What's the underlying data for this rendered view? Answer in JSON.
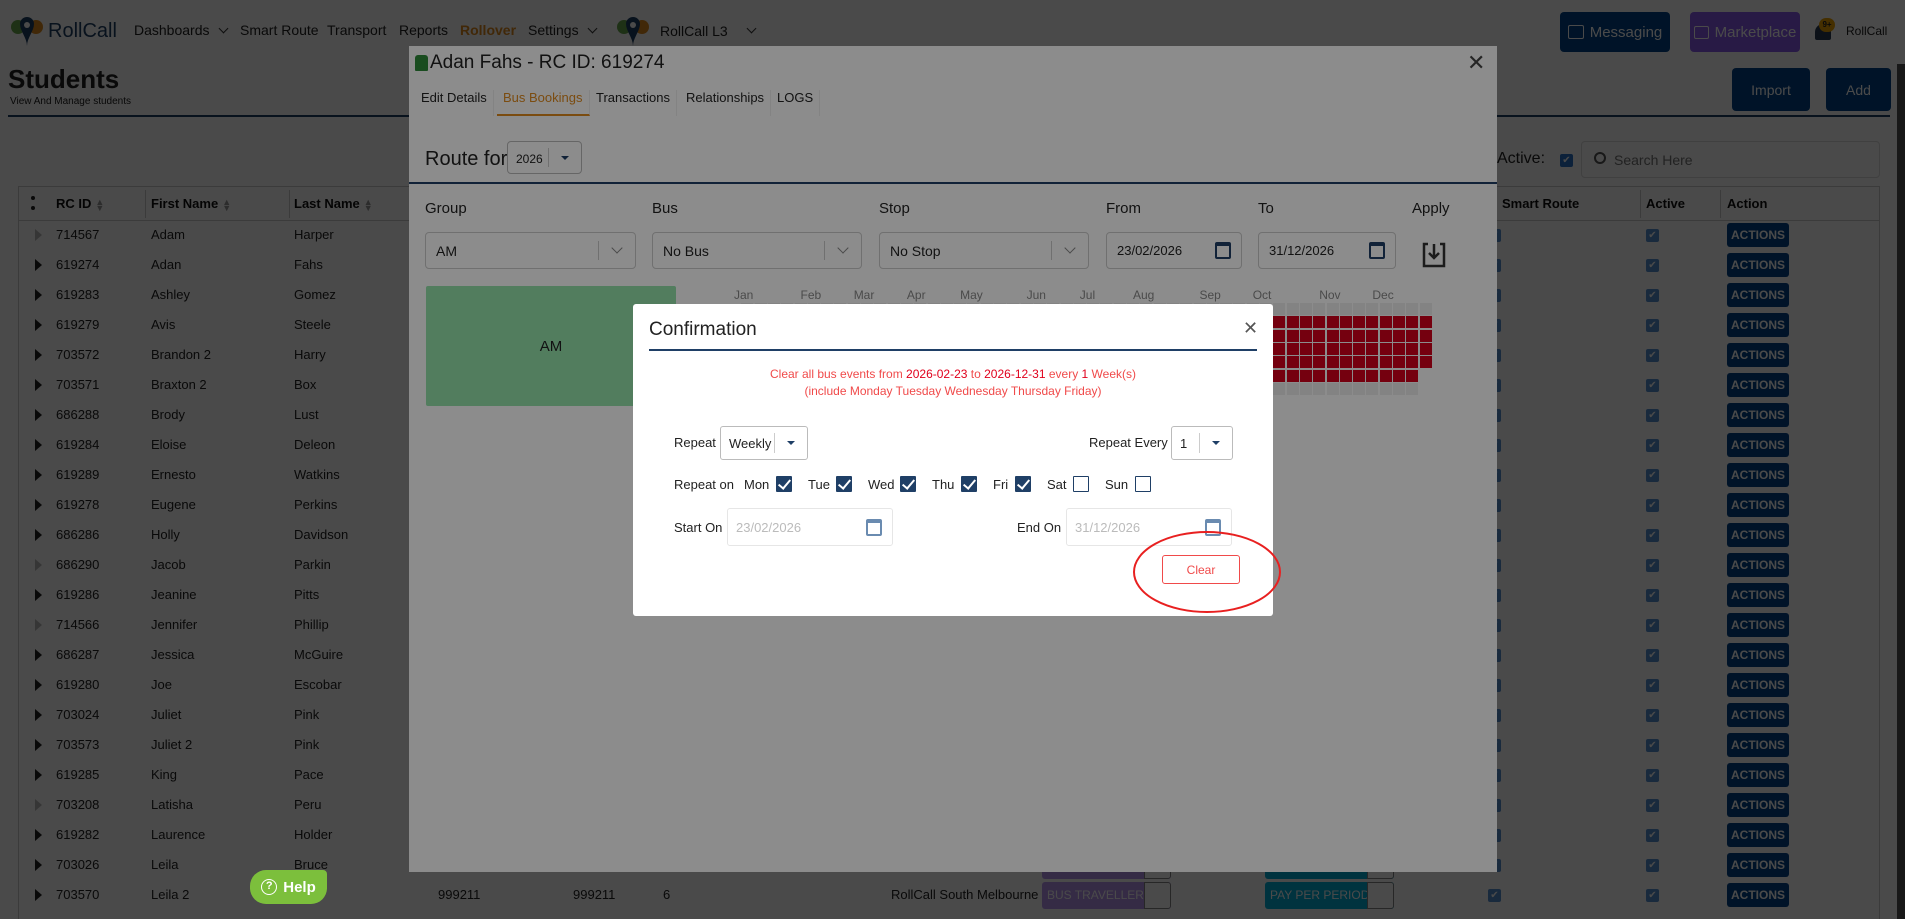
{
  "nav": {
    "brand": "RollCall",
    "items": [
      "Dashboards",
      "Smart Route",
      "Transport",
      "Reports",
      "Rollover",
      "Settings"
    ],
    "school": "RollCall L3",
    "messaging": "Messaging",
    "marketplace": "Marketplace",
    "notification_count": "9+",
    "user": "RollCall"
  },
  "page": {
    "title": "Students",
    "subtitle": "View And Manage students",
    "import": "Import",
    "add": "Add",
    "active_label": "Active:",
    "search_placeholder": "Search Here",
    "help": "Help"
  },
  "table": {
    "headers": {
      "rc_id": "RC ID",
      "first_name": "First Name",
      "last_name": "Last Name",
      "smart_route": "Smart Route",
      "active": "Active",
      "action": "Action"
    },
    "action_label": "ACTIONS",
    "rows": [
      {
        "id": "714567",
        "first": "Adam",
        "last": "Harper",
        "expandable": false
      },
      {
        "id": "619274",
        "first": "Adan",
        "last": "Fahs",
        "expandable": true
      },
      {
        "id": "619283",
        "first": "Ashley",
        "last": "Gomez",
        "expandable": true
      },
      {
        "id": "619279",
        "first": "Avis",
        "last": "Steele",
        "expandable": true
      },
      {
        "id": "703572",
        "first": "Brandon 2",
        "last": "Harry",
        "expandable": true
      },
      {
        "id": "703571",
        "first": "Braxton 2",
        "last": "Box",
        "expandable": true
      },
      {
        "id": "686288",
        "first": "Brody",
        "last": "Lust",
        "expandable": true
      },
      {
        "id": "619284",
        "first": "Eloise",
        "last": "Deleon",
        "expandable": true
      },
      {
        "id": "619289",
        "first": "Ernesto",
        "last": "Watkins",
        "expandable": true
      },
      {
        "id": "619278",
        "first": "Eugene",
        "last": "Perkins",
        "expandable": true
      },
      {
        "id": "686286",
        "first": "Holly",
        "last": "Davidson",
        "expandable": true
      },
      {
        "id": "686290",
        "first": "Jacob",
        "last": "Parkin",
        "expandable": false
      },
      {
        "id": "619286",
        "first": "Jeanine",
        "last": "Pitts",
        "expandable": true
      },
      {
        "id": "714566",
        "first": "Jennifer",
        "last": "Phillip",
        "expandable": false
      },
      {
        "id": "686287",
        "first": "Jessica",
        "last": "McGuire",
        "expandable": true
      },
      {
        "id": "619280",
        "first": "Joe",
        "last": "Escobar",
        "expandable": true
      },
      {
        "id": "703024",
        "first": "Juliet",
        "last": "Pink",
        "expandable": true
      },
      {
        "id": "703573",
        "first": "Juliet 2",
        "last": "Pink",
        "expandable": true
      },
      {
        "id": "619285",
        "first": "King",
        "last": "Pace",
        "expandable": true
      },
      {
        "id": "703208",
        "first": "Latisha",
        "last": "Peru",
        "expandable": false
      },
      {
        "id": "619282",
        "first": "Laurence",
        "last": "Holder",
        "expandable": true
      },
      {
        "id": "703026",
        "first": "Leila",
        "last": "Bruce",
        "expandable": true
      },
      {
        "id": "703570",
        "first": "Leila 2",
        "last": "",
        "expandable": true,
        "col4": "999211",
        "col5": "999211",
        "col6": "6",
        "campus": "RollCall South Melbourne",
        "type": "BUS TRAVELLER",
        "billing": "PAY PER PERIOD"
      }
    ]
  },
  "student_modal": {
    "title": "Adan Fahs - RC ID: 619274",
    "tabs": [
      "Edit Details",
      "Bus Bookings",
      "Transactions",
      "Relationships",
      "LOGS"
    ],
    "active_tab": "Bus Bookings",
    "route_for_label": "Route for",
    "year": "2026",
    "fields": {
      "group": "Group",
      "bus": "Bus",
      "stop": "Stop",
      "from": "From",
      "to": "To",
      "apply": "Apply"
    },
    "values": {
      "group": "AM",
      "bus": "No Bus",
      "stop": "No Stop",
      "from": "23/02/2026",
      "to": "31/12/2026"
    },
    "group_tile": "AM",
    "calendar": {
      "year": 2026,
      "months": [
        "Jan",
        "Feb",
        "Mar",
        "Apr",
        "May",
        "Jun",
        "Jul",
        "Aug",
        "Sep",
        "Oct",
        "Nov",
        "Dec"
      ],
      "booked_from": "2026-02-23",
      "booked_to": "2026-12-31",
      "booked_weekdays": [
        1,
        2,
        3,
        4,
        5
      ],
      "booked_color": "#d6001c",
      "empty_color": "#efefef"
    }
  },
  "confirm": {
    "title": "Confirmation",
    "msg_prefix": "Clear all bus events from ",
    "msg_from": "2026-02-23",
    "msg_to_word": " to ",
    "msg_to": "2026-12-31",
    "msg_every": " every ",
    "msg_n": "1",
    "msg_unit": " Week(s)",
    "msg_line2": "(include Monday Tuesday Wednesday Thursday Friday)",
    "repeat_label": "Repeat",
    "repeat_value": "Weekly",
    "repeat_every_label": "Repeat Every",
    "repeat_every_value": "1",
    "repeat_on_label": "Repeat on",
    "days": [
      {
        "label": "Mon",
        "checked": true
      },
      {
        "label": "Tue",
        "checked": true
      },
      {
        "label": "Wed",
        "checked": true
      },
      {
        "label": "Thu",
        "checked": true
      },
      {
        "label": "Fri",
        "checked": true
      },
      {
        "label": "Sat",
        "checked": false
      },
      {
        "label": "Sun",
        "checked": false
      }
    ],
    "start_label": "Start On",
    "start_value": "23/02/2026",
    "end_label": "End On",
    "end_value": "31/12/2026",
    "clear": "Clear"
  }
}
